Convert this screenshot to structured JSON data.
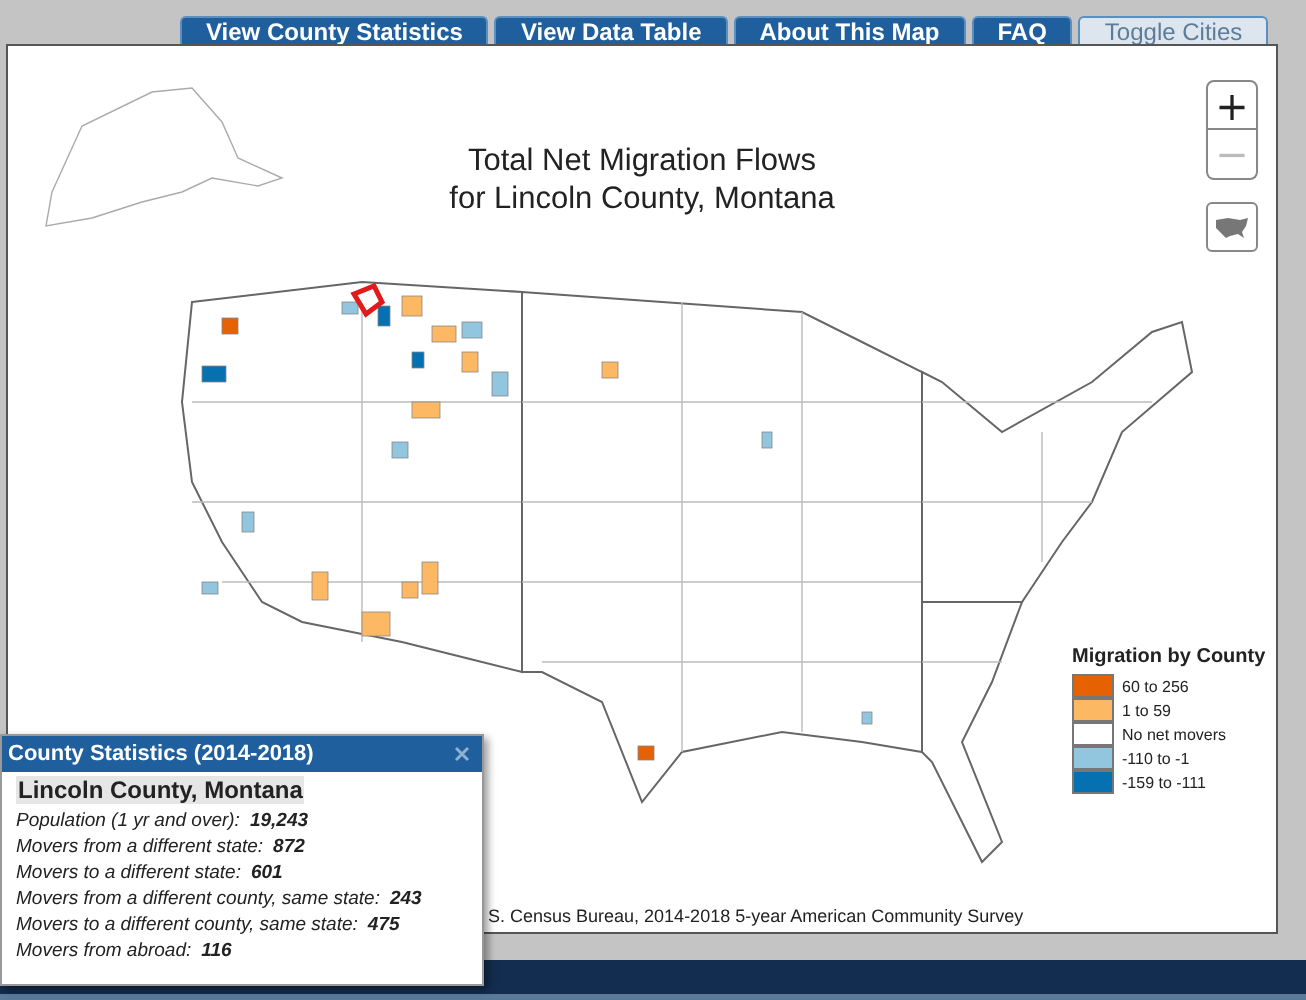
{
  "tabs": [
    {
      "label": "View County Statistics",
      "kind": "tab",
      "on": false
    },
    {
      "label": "View Data Table",
      "kind": "tab",
      "on": false
    },
    {
      "label": "About This Map",
      "kind": "tab",
      "on": false
    },
    {
      "label": "FAQ",
      "kind": "tab",
      "on": false
    },
    {
      "label": "Toggle Cities",
      "kind": "toggle",
      "on": false
    }
  ],
  "map": {
    "title_lines": [
      "Total Net Migration Flows",
      "for Lincoln County, Montana"
    ],
    "zoom_in": {
      "label": "+",
      "disabled": false
    },
    "zoom_out": {
      "label": "−",
      "disabled": true
    },
    "source": "S. Census Bureau, 2014-2018 5-year American Community Survey"
  },
  "legend": {
    "title": "Migration by County",
    "items": [
      {
        "label": "60 to 256",
        "color": "#e66101"
      },
      {
        "label": "1 to 59",
        "color": "#fdb863"
      },
      {
        "label": "No net movers",
        "color": "#ffffff"
      },
      {
        "label": "-110 to -1",
        "color": "#92c5de"
      },
      {
        "label": "-159 to -111",
        "color": "#0571b0"
      }
    ]
  },
  "popup": {
    "title": "County Statistics (2014-2018)",
    "county": "Lincoln County, Montana",
    "stats": [
      {
        "label": "Population (1 yr and over):",
        "value": "19,243"
      },
      {
        "label": "Movers from a different state:",
        "value": "872"
      },
      {
        "label": "Movers to a different state:",
        "value": "601"
      },
      {
        "label": "Movers from a different county, same state:",
        "value": "243"
      },
      {
        "label": "Movers to a different county, same state:",
        "value": "475"
      },
      {
        "label": "Movers from abroad:",
        "value": "116"
      }
    ]
  }
}
